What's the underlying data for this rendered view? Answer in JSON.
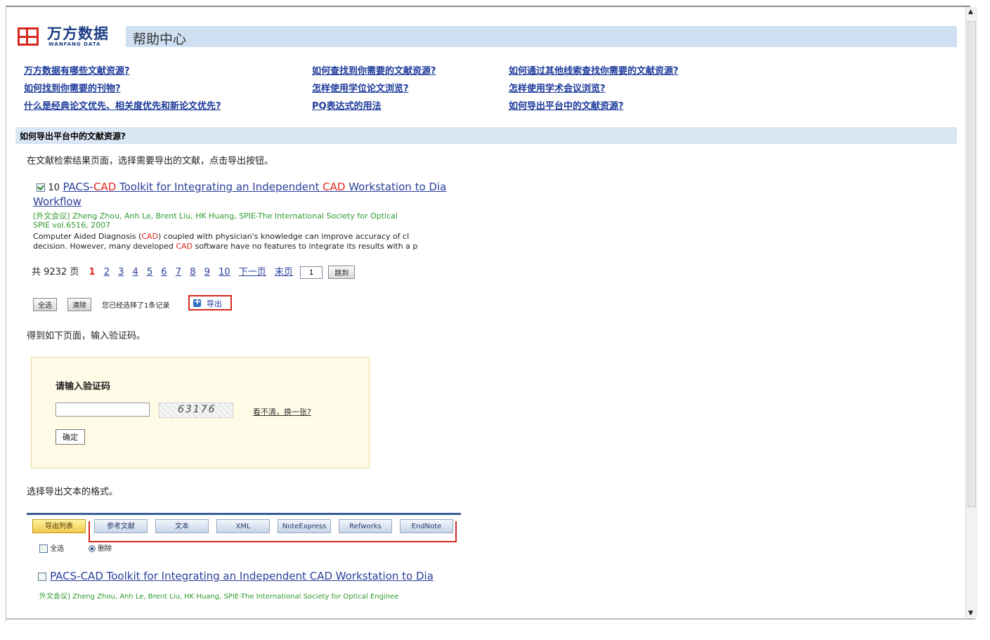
{
  "header": {
    "logo_text": "万方数据",
    "logo_sub": "WANFANG DATA",
    "title": "帮助中心"
  },
  "faq": {
    "col1": [
      "万方数据有哪些文献资源?",
      "如何找到你需要的刊物?",
      "什么是经典论文优先、相关度优先和新论文优先?"
    ],
    "col2": [
      "如何查找到你需要的文献资源?",
      "怎样使用学位论文浏览?",
      "PQ表达式的用法"
    ],
    "col3": [
      "如何通过其他线索查找你需要的文献资源?",
      "怎样使用学术会议浏览?",
      "如何导出平台中的文献资源?"
    ]
  },
  "section": {
    "title": "如何导出平台中的文献资源?",
    "step1": "在文献检索结果页面，选择需要导出的文献，点击导出按钮。",
    "step2": "得到如下页面，输入验证码。",
    "step3": "选择导出文本的格式。"
  },
  "result": {
    "number": "10",
    "title_a": "PACS-",
    "title_b": "CAD",
    "title_c": " Toolkit for Integrating an Independent ",
    "title_d": "CAD",
    "title_e": " Workstation to Dia",
    "title_line2": "Workflow",
    "meta1": "[外文会议]  Zheng Zhou, Anh Le, Brent Liu, HK Huang, SPIE-The International Society for Optical",
    "meta2": "SPIE vol.6516, 2007",
    "abstract1_a": "Computer Aided Diagnosis (",
    "abstract1_b": "CAD",
    "abstract1_c": ") coupled with physician's knowledge can improve accuracy of cl",
    "abstract2_a": "decision. However, many developed ",
    "abstract2_b": "CAD",
    "abstract2_c": " software have no features to integrate its results with a p"
  },
  "pager": {
    "total": "共 9232 页",
    "current": "1",
    "pages": [
      "2",
      "3",
      "4",
      "5",
      "6",
      "7",
      "8",
      "9",
      "10"
    ],
    "next": "下一页",
    "last": "末页",
    "input_value": "1",
    "go": "跳到"
  },
  "toolbar": {
    "select_all": "全选",
    "clear": "清除",
    "selected_text": "您已经选择了1条记录",
    "export": "导出"
  },
  "captcha": {
    "title": "请输入验证码",
    "code": "63176",
    "refresh": "看不清，换一张?",
    "ok": "确定"
  },
  "formats": {
    "buttons": [
      "导出列表",
      "参考文献",
      "文本",
      "XML",
      "NoteExpress",
      "Refworks",
      "EndNote"
    ],
    "select_all": "全选",
    "delete": "删除"
  },
  "result2": {
    "title": "PACS-CAD Toolkit for Integrating an Independent CAD Workstation to Dia",
    "meta": "[外文会议]  Zheng Zhou, Anh Le, Brent Liu, HK Huang, SPIE-The International Society for Optical Enginee"
  }
}
